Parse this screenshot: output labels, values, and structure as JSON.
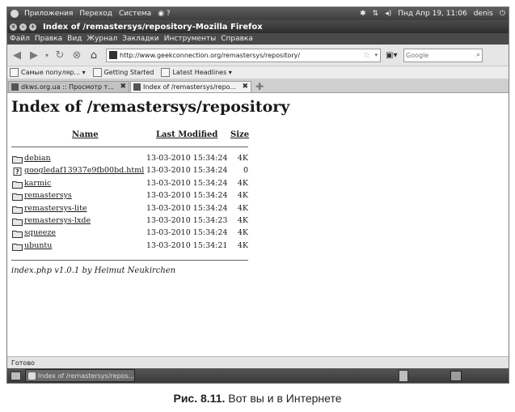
{
  "panel": {
    "applications": "Приложения",
    "places": "Переход",
    "system": "Система",
    "clock": "Пнд Апр 19, 11:06",
    "user": "denis"
  },
  "window": {
    "title": "Index of /remastersys/repository-Mozilla Firefox"
  },
  "menu": [
    "Файл",
    "Правка",
    "Вид",
    "Журнал",
    "Закладки",
    "Инструменты",
    "Справка"
  ],
  "nav": {
    "url": "http://www.geekconnection.org/remastersys/repository/",
    "search_placeholder": "Google"
  },
  "bookmarks": [
    {
      "label": "Самые популяр... ▾",
      "icon": "bookmark-folder-icon"
    },
    {
      "label": "Getting Started",
      "icon": "page-icon"
    },
    {
      "label": "Latest Headlines ▾",
      "icon": "rss-icon"
    }
  ],
  "tabs": [
    {
      "label": "dkws.org.ua :: Просмотр т...",
      "active": false
    },
    {
      "label": "Index of /remastersys/repo...",
      "active": true
    }
  ],
  "page": {
    "heading": "Index of /remastersys/repository",
    "col_name": "Name",
    "col_modified": "Last Modified",
    "col_size": "Size",
    "entries": [
      {
        "name": "debian",
        "date": "13-03-2010 15:34:24",
        "size": "4K",
        "icon": "folder-icon"
      },
      {
        "name": "googledaf13937e9fb00bd.html",
        "date": "13-03-2010 15:34:24",
        "size": "0",
        "icon": "unknown-file-icon"
      },
      {
        "name": "karmic",
        "date": "13-03-2010 15:34:24",
        "size": "4K",
        "icon": "folder-icon"
      },
      {
        "name": "remastersys",
        "date": "13-03-2010 15:34:24",
        "size": "4K",
        "icon": "folder-icon"
      },
      {
        "name": "remastersys-lite",
        "date": "13-03-2010 15:34:24",
        "size": "4K",
        "icon": "folder-icon"
      },
      {
        "name": "remastersys-lxde",
        "date": "13-03-2010 15:34:23",
        "size": "4K",
        "icon": "folder-icon"
      },
      {
        "name": "squeeze",
        "date": "13-03-2010 15:34:24",
        "size": "4K",
        "icon": "folder-icon"
      },
      {
        "name": "ubuntu",
        "date": "13-03-2010 15:34:21",
        "size": "4K",
        "icon": "folder-icon"
      }
    ],
    "footer": "index.php v1.0.1 by Heimut Neukirchen"
  },
  "status": "Готово",
  "taskbar": {
    "task": "Index of /remastersys/repos..."
  },
  "caption": {
    "number": "Рис. 8.11.",
    "text": "Вот вы и в Интернете"
  }
}
